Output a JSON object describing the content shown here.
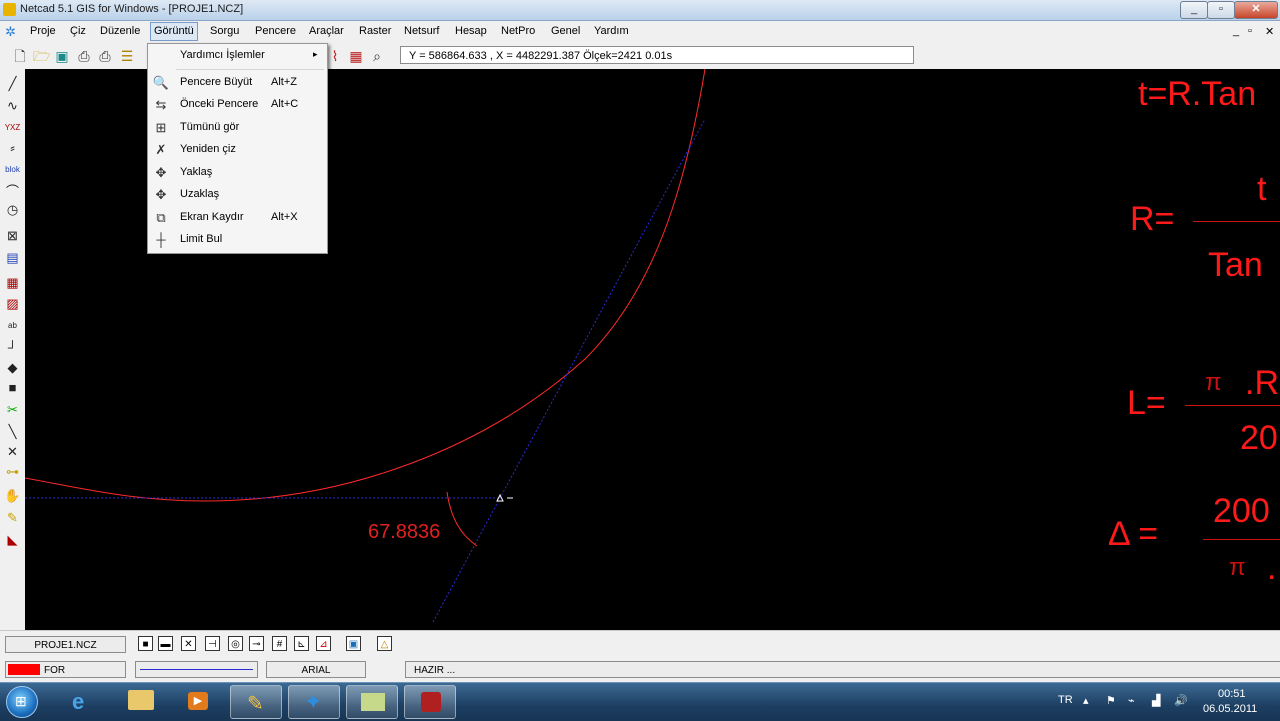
{
  "window": {
    "title": "Netcad 5.1 GIS for Windows - [PROJE1.NCZ]",
    "controls": [
      "_",
      "▫",
      "✕"
    ],
    "mdi_controls": [
      "_",
      "▫",
      "✕"
    ]
  },
  "menubar": [
    "Proje",
    "Çiz",
    "Düzenle",
    "Görüntü",
    "Sorgu",
    "Pencere",
    "Araçlar",
    "Raster",
    "Netsurf",
    "Hesap",
    "NetPro",
    "Genel",
    "Yardım"
  ],
  "coordinates": "Y = 586864.633 , X = 4482291.387  Ölçek=2421   0.01s",
  "dropdown": {
    "submenu": {
      "label": "Yardımcı İşlemler",
      "arrow": "▸"
    },
    "items": [
      {
        "label": "Pencere Büyüt",
        "shortcut": "Alt+Z",
        "icon": "zoom-window-icon"
      },
      {
        "label": "Önceki Pencere",
        "shortcut": "Alt+C",
        "icon": "previous-view-icon"
      },
      {
        "label": "Tümünü gör",
        "shortcut": "",
        "icon": "zoom-all-icon"
      },
      {
        "label": "Yeniden çiz",
        "shortcut": "",
        "icon": "redraw-icon"
      },
      {
        "label": "Yaklaş",
        "shortcut": "",
        "icon": "zoom-in-icon"
      },
      {
        "label": "Uzaklaş",
        "shortcut": "",
        "icon": "zoom-out-icon"
      },
      {
        "label": "Ekran Kaydır",
        "shortcut": "Alt+X",
        "icon": "pan-icon"
      },
      {
        "label": "Limit Bul",
        "shortcut": "",
        "icon": "find-limits-icon"
      }
    ]
  },
  "canvas": {
    "angle_label": "67.8836",
    "formulas": {
      "f1": "t=R.Tan",
      "f2_num": "t",
      "f2_lhs": "R=",
      "f2_den": "Tan",
      "f3_lhs": "L=",
      "f3_num_pi": "π",
      "f3_num": ".R",
      "f3_den": "20",
      "f4_lhs": "Δ =",
      "f4_num": "200",
      "f4_den_pi": "π",
      "f4_den": "."
    },
    "colors": {
      "curve": "#ff2a2a",
      "tangent": "#2b2bd6",
      "text": "#ff1a1a"
    }
  },
  "status": {
    "file": "PROJE1.NCZ",
    "layer": "FOR",
    "layer_color": "#ff0000",
    "font": "ARIAL",
    "message": "HAZIR ..."
  },
  "taskbar": {
    "language": "TR",
    "time": "00:51",
    "date": "06.05.2011"
  }
}
